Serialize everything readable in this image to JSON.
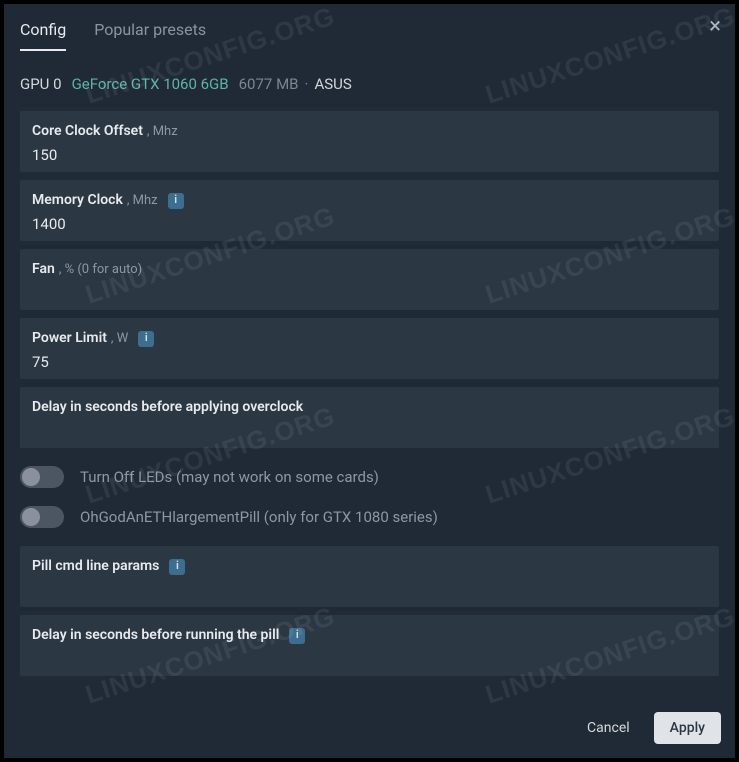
{
  "tabs": {
    "config": "Config",
    "presets": "Popular presets"
  },
  "close": "×",
  "gpu": {
    "slot": "GPU 0",
    "name": "GeForce GTX 1060 6GB",
    "memory": "6077 MB",
    "dot": "·",
    "vendor": "ASUS"
  },
  "fields": {
    "core_clock": {
      "label": "Core Clock Offset",
      "unit": ", Mhz",
      "value": "150"
    },
    "mem_clock": {
      "label": "Memory Clock",
      "unit": ", Mhz",
      "value": "1400",
      "info": "i"
    },
    "fan": {
      "label": "Fan",
      "unit": ", % (0 for auto)",
      "value": ""
    },
    "power": {
      "label": "Power Limit",
      "unit": ", W",
      "value": "75",
      "info": "i"
    },
    "delay_oc": {
      "label": "Delay in seconds before applying overclock",
      "value": ""
    },
    "pill_params": {
      "label": "Pill cmd line params",
      "value": "",
      "info": "i"
    },
    "delay_pill": {
      "label": "Delay in seconds before running the pill",
      "value": "",
      "info": "i"
    }
  },
  "toggles": {
    "leds": "Turn Off LEDs (may not work on some cards)",
    "pill": "OhGodAnETHlargementPill (only for GTX 1080 series)"
  },
  "buttons": {
    "cancel": "Cancel",
    "apply": "Apply"
  },
  "watermark": "LINUXCONFIG.ORG"
}
